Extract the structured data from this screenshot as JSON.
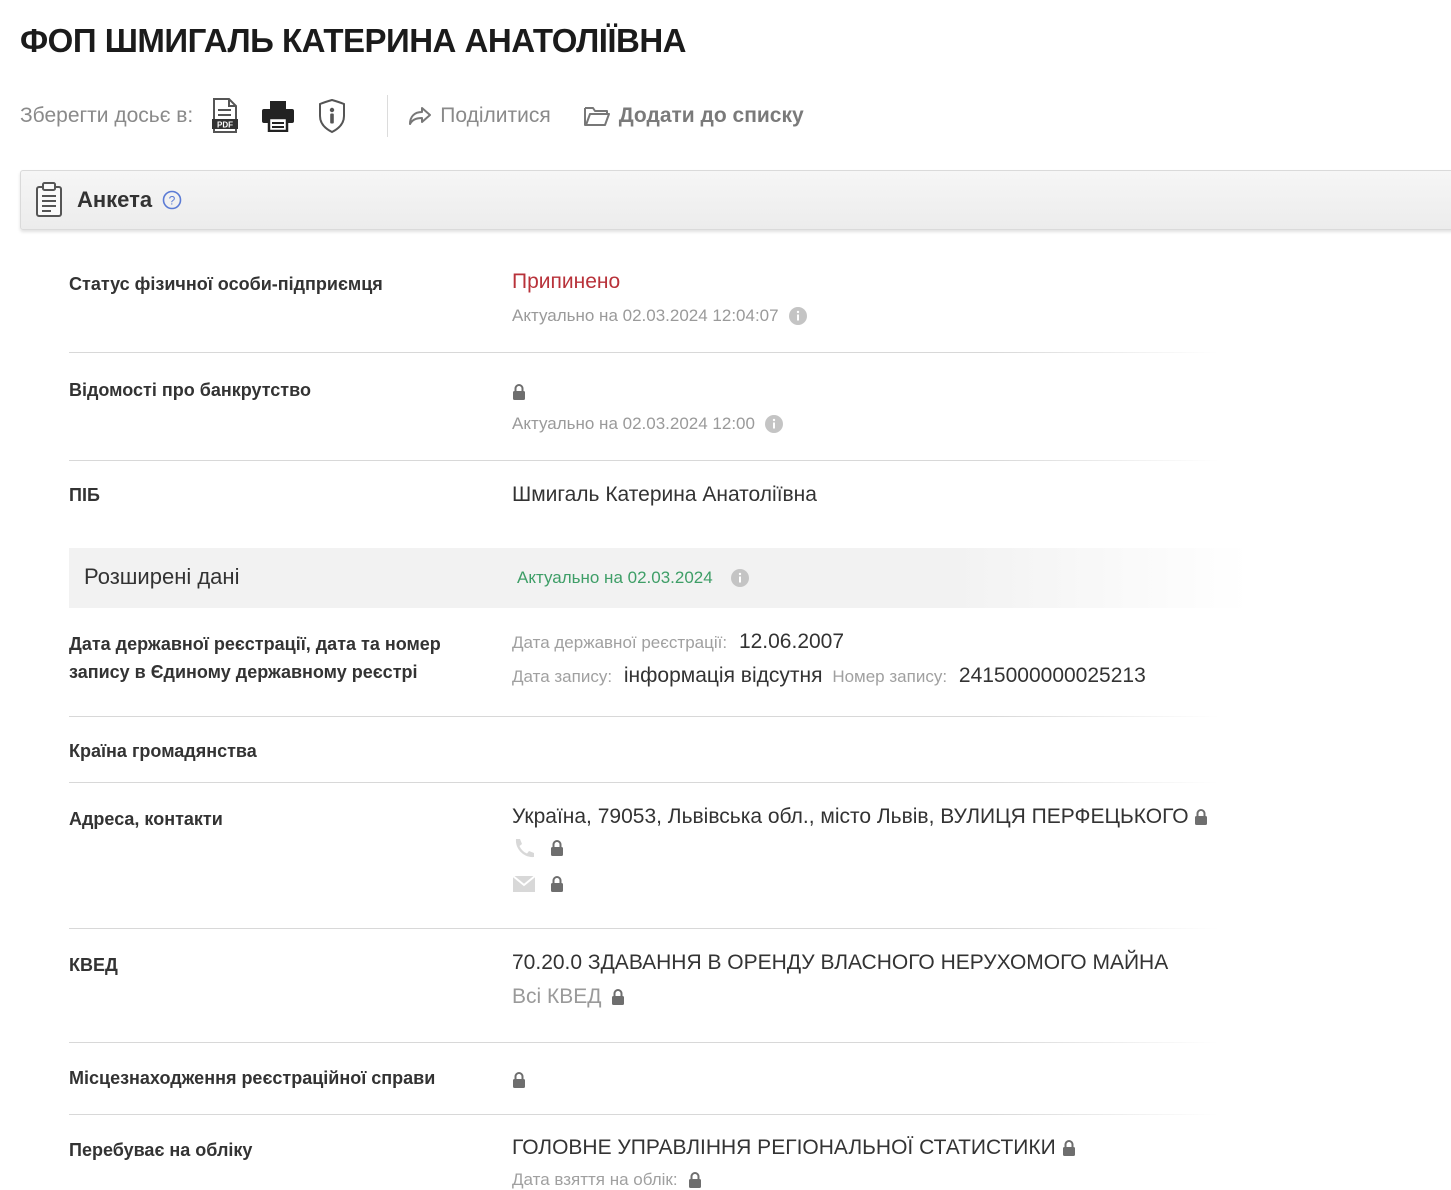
{
  "header": {
    "title": "ФОП ШМИГАЛЬ КАТЕРИНА АНАТОЛІЇВНА"
  },
  "toolbar": {
    "save_label": "Зберегти досьє в:",
    "icons": [
      "pdf-icon",
      "printer-icon",
      "shield-icon"
    ],
    "share_label": "Поділитися",
    "add_to_list_label": "Додати до списку"
  },
  "panel": {
    "title": "Анкета"
  },
  "rows": {
    "status": {
      "label": "Статус фізичної особи-підприємця",
      "value": "Припинено",
      "meta": "Актуально на 02.03.2024 12:04:07",
      "value_color": "#b8323a"
    },
    "bankruptcy": {
      "label": "Відомості про банкрутство",
      "meta": "Актуально на 02.03.2024 12:00"
    },
    "name": {
      "label": "ПІБ",
      "value": "Шмигаль Катерина Анатоліївна"
    },
    "extended": {
      "title": "Розширені дані",
      "meta": "Актуально на 02.03.2024",
      "meta_color": "#3e9e67"
    },
    "registration": {
      "label": "Дата державної реєстрації, дата та номер запису в Єдиному державному реєстрі",
      "reg_date_label": "Дата державної реєстрації:",
      "reg_date": "12.06.2007",
      "record_date_label": "Дата запису:",
      "record_date": "інформація відсутня",
      "record_number_label": "Номер запису:",
      "record_number": "2415000000025213"
    },
    "citizenship": {
      "label": "Країна громадянства"
    },
    "address": {
      "label": "Адреса, контакти",
      "value": "Україна, 79053, Львівська обл., місто Львів, ВУЛИЦЯ ПЕРФЕЦЬКОГО"
    },
    "kved": {
      "label": "КВЕД",
      "value": "70.20.0 ЗДАВАННЯ В ОРЕНДУ ВЛАСНОГО НЕРУХОМОГО МАЙНА",
      "all_link": "Всі КВЕД"
    },
    "reg_case": {
      "label": "Місцезнаходження реєстраційної справи"
    },
    "accounting": {
      "label": "Перебуває на обліку",
      "value": "ГОЛОВНЕ УПРАВЛІННЯ РЕГІОНАЛЬНОЇ СТАТИСТИКИ",
      "date_label": "Дата взяття на облік:"
    }
  }
}
